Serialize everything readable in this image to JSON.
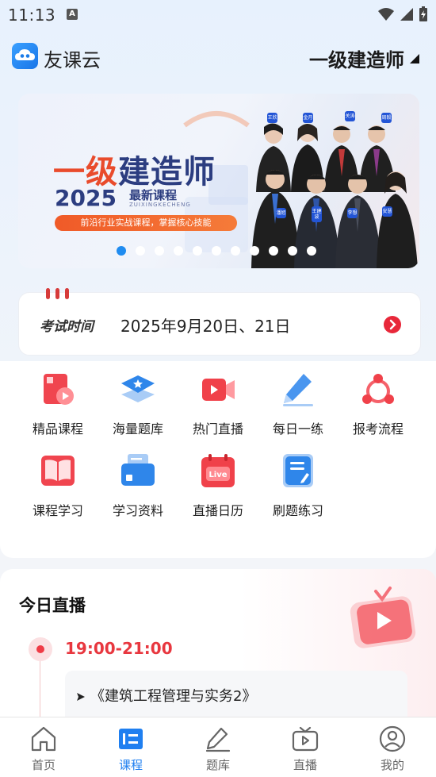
{
  "status_bar": {
    "time": "11:13",
    "notification_icon": "a-icon"
  },
  "header": {
    "app_name": "友课云",
    "exam_selector": "一级建造师"
  },
  "banner": {
    "title_part1": "一级",
    "title_part2": "建造师",
    "year": "2025",
    "subtitle": "最新课程",
    "subtitle_en": "ZUIXINGKECHENG",
    "tagline": "前沿行业实战课程，掌握核心技能",
    "teachers_back": [
      "王欣",
      "金月",
      "关涛",
      "周毅"
    ],
    "teachers_front": [
      "潘旭",
      "王建波",
      "李想",
      "安慧"
    ],
    "dot_count": 11,
    "active_dot": 0
  },
  "exam": {
    "label": "考试时间",
    "value": "2025年9月20日、21日"
  },
  "grid": [
    {
      "label": "精品课程",
      "icon": "book-play-icon"
    },
    {
      "label": "海量题库",
      "icon": "layers-star-icon"
    },
    {
      "label": "热门直播",
      "icon": "video-camera-icon"
    },
    {
      "label": "每日一练",
      "icon": "pencil-icon"
    },
    {
      "label": "报考流程",
      "icon": "flow-nodes-icon"
    },
    {
      "label": "课程学习",
      "icon": "open-book-icon"
    },
    {
      "label": "学习资料",
      "icon": "folder-docs-icon"
    },
    {
      "label": "直播日历",
      "icon": "live-calendar-icon"
    },
    {
      "label": "刷题练习",
      "icon": "note-edit-icon"
    }
  ],
  "live": {
    "title": "今日直播",
    "time": "19:00-21:00",
    "course": "《建筑工程管理与实务2》"
  },
  "tabs": [
    {
      "label": "首页",
      "icon": "home-icon"
    },
    {
      "label": "课程",
      "icon": "course-icon",
      "active": true
    },
    {
      "label": "题库",
      "icon": "edit-icon"
    },
    {
      "label": "直播",
      "icon": "tv-play-icon"
    },
    {
      "label": "我的",
      "icon": "user-icon"
    }
  ],
  "colors": {
    "accent_blue": "#1f7ff0",
    "accent_red": "#e8373f",
    "banner_orange": "#f05a28"
  }
}
